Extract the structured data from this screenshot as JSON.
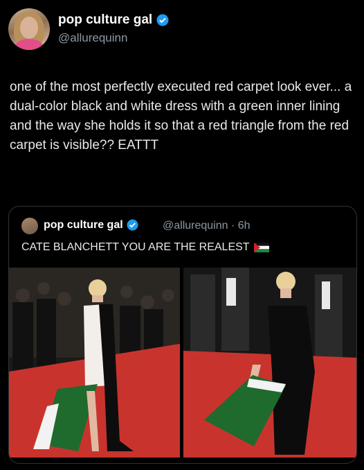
{
  "author": {
    "name": "pop culture gal",
    "handle": "@allurequinn",
    "verified_icon": "verified-badge-icon"
  },
  "tweet": {
    "text": "one of the most perfectly executed red carpet look ever... a dual-color black and white dress with a green inner lining and the way she holds it so that a red triangle from the red carpet is visible?? EATTT"
  },
  "quoted": {
    "name": "pop culture gal",
    "handle_time": "@allurequinn · 6h",
    "text": "CATE BLANCHETT YOU ARE THE REALEST",
    "flag_icon": "palestine-flag-icon"
  },
  "colors": {
    "background": "#000000",
    "text": "#e7e9ea",
    "muted": "#8b98a5",
    "verified": "#1d9bf0",
    "carpet": "#c8342d"
  }
}
